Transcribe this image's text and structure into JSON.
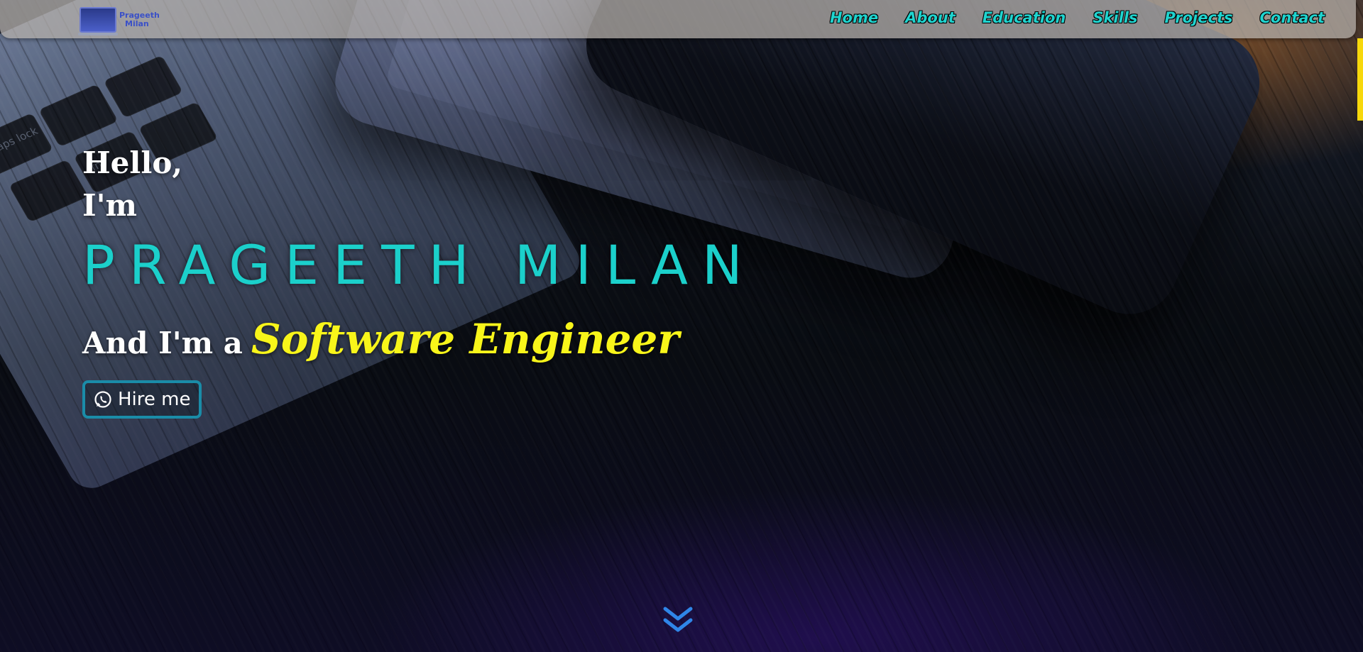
{
  "logo": {
    "line1": "Prageeth",
    "line2": "Milan",
    "icon": "laptop-logo-icon"
  },
  "nav": {
    "items": [
      "Home",
      "About",
      "Education",
      "Skills",
      "Projects",
      "Contact"
    ]
  },
  "hero": {
    "greeting_line1": "Hello,",
    "greeting_line2": "I'm",
    "name": "PRAGEETH MILAN",
    "role_prefix": "And I'm a",
    "role_title": "Software Engineer",
    "hire_label": "Hire me",
    "hire_icon": "whatsapp-icon",
    "scroll_icon": "double-chevron-down-icon"
  },
  "colors": {
    "accent_cyan": "#1bd0cb",
    "accent_yellow": "#f8f51a",
    "button_border": "#1a8ca8",
    "scroll_icon": "#2f86e8",
    "scrollbar_accent": "#f7d80b"
  }
}
